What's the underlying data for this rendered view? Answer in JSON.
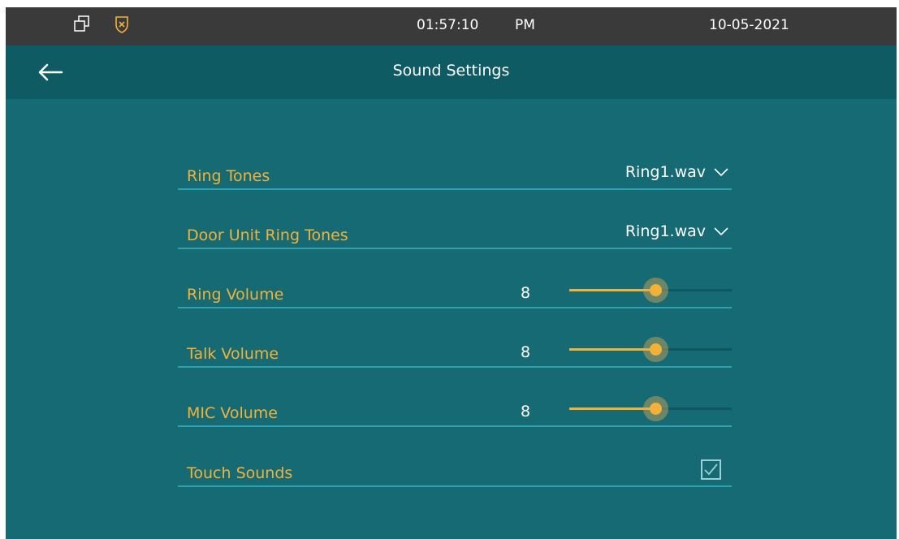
{
  "status_bar": {
    "time": "01:57:10",
    "ampm": "PM",
    "date": "10-05-2021",
    "icons": [
      "windows-icon",
      "shield-icon"
    ]
  },
  "header": {
    "title": "Sound Settings",
    "back_icon": "back-arrow-icon"
  },
  "settings": {
    "ring_tones": {
      "label": "Ring Tones",
      "value": "Ring1.wav"
    },
    "door_unit_ring_tones": {
      "label": "Door Unit Ring Tones",
      "value": "Ring1.wav"
    },
    "ring_volume": {
      "label": "Ring Volume",
      "value": "8",
      "level": 0.53
    },
    "talk_volume": {
      "label": "Talk Volume",
      "value": "8",
      "level": 0.53
    },
    "mic_volume": {
      "label": "MIC Volume",
      "value": "8",
      "level": 0.53
    },
    "touch_sounds": {
      "label": "Touch Sounds",
      "checked": true
    }
  },
  "colors": {
    "background": "#156a73",
    "header": "#0f5b64",
    "status_bar": "#3a3a3a",
    "accent": "#f2b23a",
    "divider": "#2fa0ad"
  }
}
